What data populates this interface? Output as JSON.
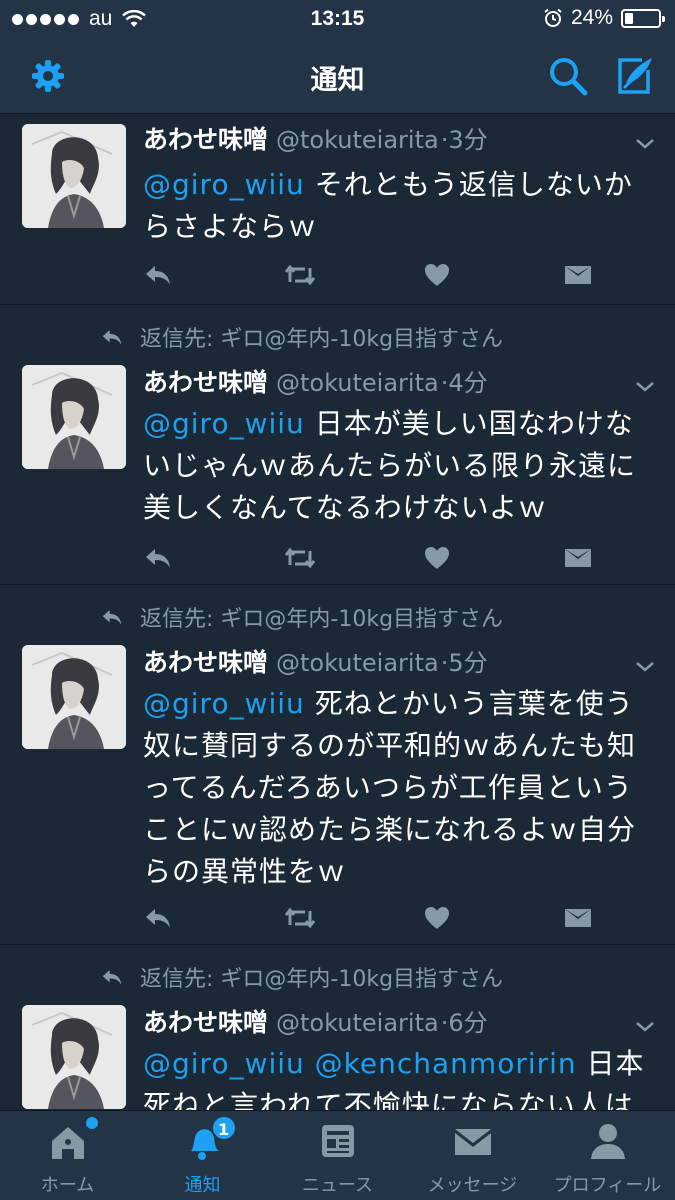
{
  "status_bar": {
    "carrier": "au",
    "time": "13:15",
    "battery": "24%",
    "battery_level": 0.24
  },
  "nav": {
    "title": "通知"
  },
  "tweets": [
    {
      "reply_to": "",
      "name": "あわせ味噌",
      "handle": "@tokuteiarita",
      "time": "·3分",
      "mention": "@giro_wiiu",
      "text": " それともう返信しないからさよならｗ"
    },
    {
      "reply_to": "返信先: ギロ@年内-10kg目指すさん",
      "name": "あわせ味噌",
      "handle": "@tokuteiarita",
      "time": "·4分",
      "mention": "@giro_wiiu",
      "text": " 日本が美しい国なわけないじゃんｗあんたらがいる限り永遠に美しくなんてなるわけないよｗ"
    },
    {
      "reply_to": "返信先: ギロ@年内-10kg目指すさん",
      "name": "あわせ味噌",
      "handle": "@tokuteiarita",
      "time": "·5分",
      "mention": "@giro_wiiu",
      "text": " 死ねとかいう言葉を使う奴に賛同するのが平和的ｗあんたも知ってるんだろあいつらが工作員ということにｗ認めたら楽になれるよｗ自分らの異常性をｗ"
    },
    {
      "reply_to": "返信先: ギロ@年内-10kg目指すさん",
      "name": "あわせ味噌",
      "handle": "@tokuteiarita",
      "time": "·6分",
      "mention": "@giro_wiiu @kenchanmoririn",
      "text": " 日本死ねと言われて不愉快にならない人は"
    }
  ],
  "tabs": [
    {
      "label": "ホーム",
      "icon": "home-icon"
    },
    {
      "label": "通知",
      "icon": "bell-icon",
      "badge": "1"
    },
    {
      "label": "ニュース",
      "icon": "news-icon"
    },
    {
      "label": "メッセージ",
      "icon": "mail-icon"
    },
    {
      "label": "プロフィール",
      "icon": "profile-icon"
    }
  ],
  "colors": {
    "accent": "#1da1f2",
    "background": "#1b2836",
    "bar": "#243447",
    "muted": "#8899a6"
  }
}
